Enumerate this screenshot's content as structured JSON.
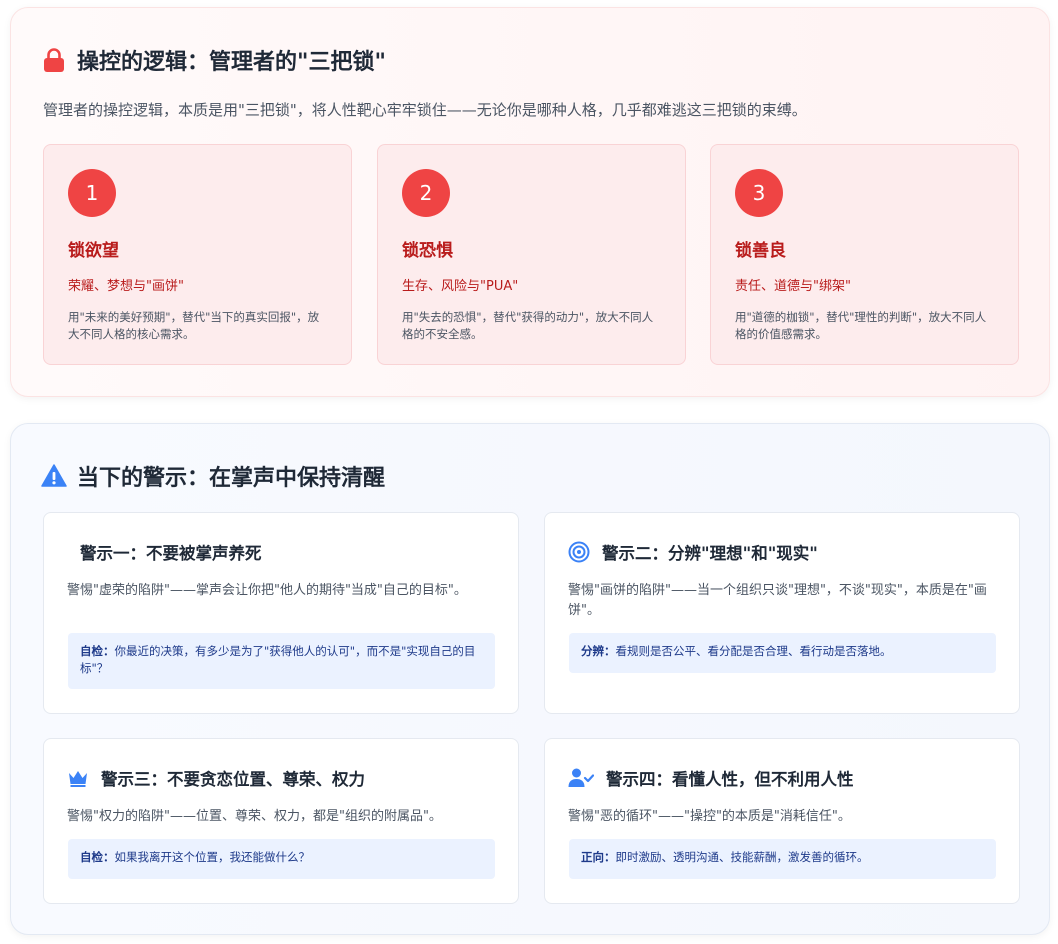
{
  "section1": {
    "title": "操控的逻辑：管理者的\"三把锁\"",
    "title_icon": "lock-icon",
    "intro": "管理者的操控逻辑，本质是用\"三把锁\"，将人性靶心牢牢锁住——无论你是哪种人格，几乎都难逃这三把锁的束缚。",
    "locks": [
      {
        "num": "1",
        "name": "锁欲望",
        "sub": "荣耀、梦想与\"画饼\"",
        "desc": "用\"未来的美好预期\"，替代\"当下的真实回报\"，放大不同人格的核心需求。"
      },
      {
        "num": "2",
        "name": "锁恐惧",
        "sub": "生存、风险与\"PUA\"",
        "desc": "用\"失去的恐惧\"，替代\"获得的动力\"，放大不同人格的不安全感。"
      },
      {
        "num": "3",
        "name": "锁善良",
        "sub": "责任、道德与\"绑架\"",
        "desc": "用\"道德的枷锁\"，替代\"理性的判断\"，放大不同人格的价值感需求。"
      }
    ]
  },
  "section2": {
    "title": "当下的警示：在掌声中保持清醒",
    "title_icon": "warning-icon",
    "warnings": [
      {
        "title": "警示一：不要被掌声养死",
        "icon": "clap-icon",
        "desc": "警惕\"虚荣的陷阱\"——掌声会让你把\"他人的期待\"当成\"自己的目标\"。",
        "box_label": "自检：",
        "box_text": "你最近的决策，有多少是为了\"获得他人的认可\"，而不是\"实现自己的目标\"？"
      },
      {
        "title": "警示二：分辨\"理想\"和\"现实\"",
        "icon": "target-icon",
        "desc": "警惕\"画饼的陷阱\"——当一个组织只谈\"理想\"，不谈\"现实\"，本质是在\"画饼\"。",
        "box_label": "分辨：",
        "box_text": "看规则是否公平、看分配是否合理、看行动是否落地。"
      },
      {
        "title": "警示三：不要贪恋位置、尊荣、权力",
        "icon": "crown-icon",
        "desc": "警惕\"权力的陷阱\"——位置、尊荣、权力，都是\"组织的附属品\"。",
        "box_label": "自检：",
        "box_text": "如果我离开这个位置，我还能做什么？"
      },
      {
        "title": "警示四：看懂人性，但不利用人性",
        "icon": "user-check-icon",
        "desc": "警惕\"恶的循环\"——\"操控\"的本质是\"消耗信任\"。",
        "box_label": "正向：",
        "box_text": "即时激励、透明沟通、技能薪酬，激发善的循环。"
      }
    ]
  },
  "colors": {
    "lock_accent": "#ef4444",
    "lock_text": "#b91c1c",
    "warn_accent": "#3b82f6",
    "box_bg": "#ebf2ff"
  }
}
